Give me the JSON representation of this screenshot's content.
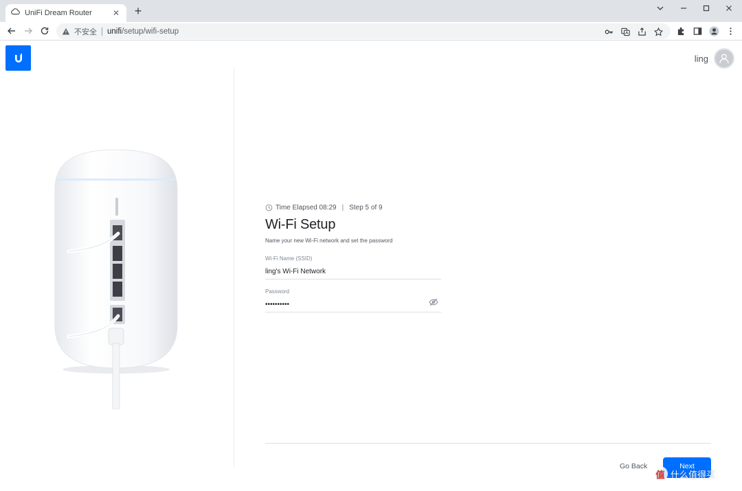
{
  "browser": {
    "tab_title": "UniFi Dream Router",
    "new_tab": "+",
    "security_label": "不安全",
    "url_host": "unifi",
    "url_path": "/setup/wifi-setup"
  },
  "header": {
    "username": "ling"
  },
  "setup": {
    "time_elapsed": "Time Elapsed 08:29",
    "divider": "|",
    "step": "Step 5 of 9",
    "title": "Wi-Fi Setup",
    "subtitle": "Name your new Wi-Fi network and set the password",
    "ssid_label": "Wi-Fi Name (SSID)",
    "ssid_value": "ling's Wi-Fi Network",
    "password_label": "Password",
    "password_value": "••••••••••"
  },
  "footer": {
    "go_back": "Go Back",
    "next": "Next"
  },
  "watermark": {
    "icon_text": "值",
    "text": "什么值得买"
  },
  "colors": {
    "accent": "#006fff",
    "text_primary": "#212327",
    "text_secondary": "#50565e"
  }
}
